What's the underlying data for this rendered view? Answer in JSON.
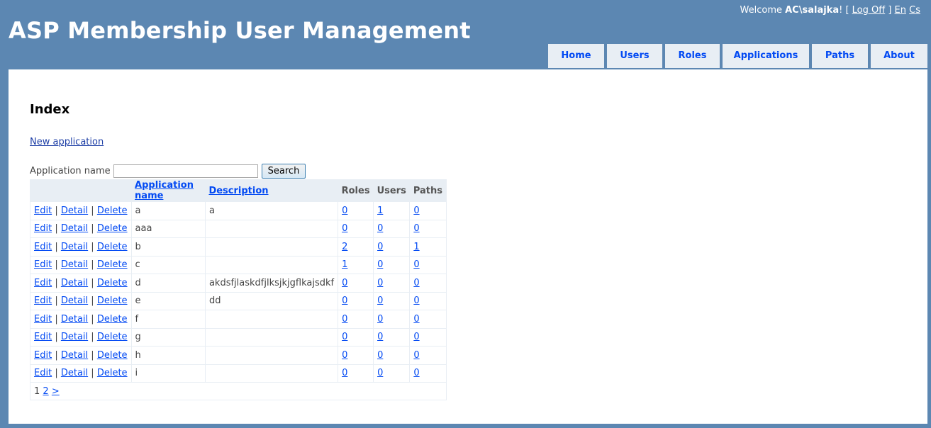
{
  "header": {
    "title": "ASP Membership User Management",
    "welcome_prefix": "Welcome ",
    "username": "AC\\salajka",
    "welcome_suffix": "! [ ",
    "logoff_label": "Log Off",
    "bracket_close": " ] ",
    "lang_en": "En",
    "lang_cs": "Cs"
  },
  "menu": [
    {
      "label": "Home"
    },
    {
      "label": "Users"
    },
    {
      "label": "Roles"
    },
    {
      "label": "Applications"
    },
    {
      "label": "Paths"
    },
    {
      "label": "About"
    }
  ],
  "main": {
    "page_title": "Index",
    "new_application_label": "New application",
    "search_label": "Application name",
    "search_value": "",
    "search_button": "Search"
  },
  "table": {
    "headers": [
      "Application name",
      "Description",
      "Roles",
      "Users",
      "Paths"
    ],
    "action_edit": "Edit",
    "action_detail": "Detail",
    "action_delete": "Delete",
    "separator": "|",
    "rows": [
      {
        "name": "a",
        "description": "a",
        "roles": "0",
        "users": "1",
        "paths": "0"
      },
      {
        "name": "aaa",
        "description": "",
        "roles": "0",
        "users": "0",
        "paths": "0"
      },
      {
        "name": "b",
        "description": "",
        "roles": "2",
        "users": "0",
        "paths": "1"
      },
      {
        "name": "c",
        "description": "",
        "roles": "1",
        "users": "0",
        "paths": "0"
      },
      {
        "name": "d",
        "description": "akdsfjlaskdfjlksjkjgflkajsdkf",
        "roles": "0",
        "users": "0",
        "paths": "0"
      },
      {
        "name": "e",
        "description": "dd",
        "roles": "0",
        "users": "0",
        "paths": "0"
      },
      {
        "name": "f",
        "description": "",
        "roles": "0",
        "users": "0",
        "paths": "0"
      },
      {
        "name": "g",
        "description": "",
        "roles": "0",
        "users": "0",
        "paths": "0"
      },
      {
        "name": "h",
        "description": "",
        "roles": "0",
        "users": "0",
        "paths": "0"
      },
      {
        "name": "i",
        "description": "",
        "roles": "0",
        "users": "0",
        "paths": "0"
      }
    ],
    "pager": {
      "current": "1",
      "page2": "2",
      "next": ">"
    }
  },
  "colors": {
    "background": "#5c87b2",
    "menu_bg": "#e8eef4",
    "link": "#034af3"
  }
}
